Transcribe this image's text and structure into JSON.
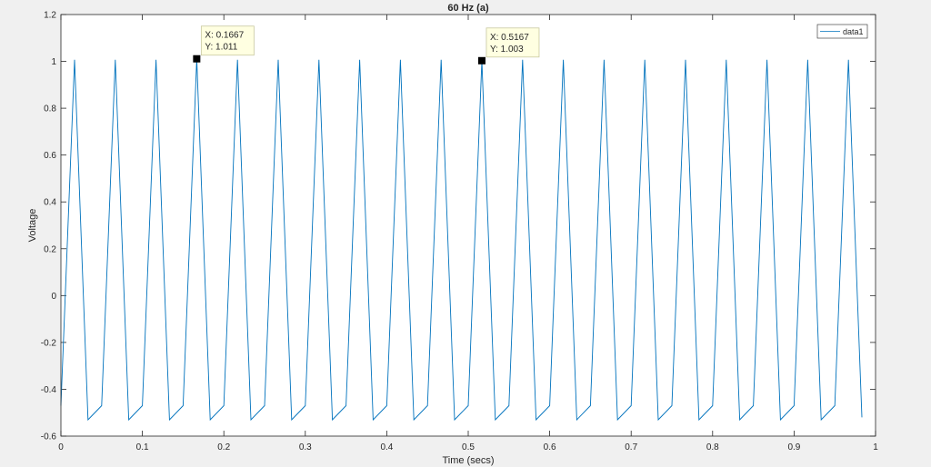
{
  "chart_data": {
    "type": "line",
    "title": "60 Hz (a)",
    "xlabel": "Time (secs)",
    "ylabel": "Voltage",
    "xlim": [
      0,
      1
    ],
    "ylim": [
      -0.6,
      1.2
    ],
    "xticks": [
      0,
      0.1,
      0.2,
      0.3,
      0.4,
      0.5,
      0.6,
      0.7,
      0.8,
      0.9,
      1
    ],
    "xtick_labels": [
      "0",
      "0.1",
      "0.2",
      "0.3",
      "0.4",
      "0.5",
      "0.6",
      "0.7",
      "0.8",
      "0.9",
      "1"
    ],
    "yticks": [
      -0.6,
      -0.4,
      -0.2,
      0,
      0.2,
      0.4,
      0.6,
      0.8,
      1,
      1.2
    ],
    "ytick_labels": [
      "-0.6",
      "-0.4",
      "-0.2",
      "0",
      "0.2",
      "0.4",
      "0.6",
      "0.8",
      "1",
      "1.2"
    ],
    "grid": false,
    "legend": {
      "placement": "top-right",
      "entries": [
        "data1"
      ]
    },
    "series": [
      {
        "name": "data1",
        "color": "#0072bd",
        "x": [
          0,
          0.0167,
          0.0333,
          0.05,
          0.0667,
          0.0833,
          0.1,
          0.1167,
          0.1333,
          0.15,
          0.1667,
          0.1833,
          0.2,
          0.2167,
          0.2333,
          0.25,
          0.2667,
          0.2833,
          0.3,
          0.3167,
          0.3333,
          0.35,
          0.3667,
          0.3833,
          0.4,
          0.4167,
          0.4333,
          0.45,
          0.4667,
          0.4833,
          0.5,
          0.5167,
          0.5333,
          0.55,
          0.5667,
          0.5833,
          0.6,
          0.6167,
          0.6333,
          0.65,
          0.6667,
          0.6833,
          0.7,
          0.7167,
          0.7333,
          0.75,
          0.7667,
          0.7833,
          0.8,
          0.8167,
          0.8333,
          0.85,
          0.8667,
          0.8833,
          0.9,
          0.9167,
          0.9333,
          0.95,
          0.9667,
          0.9833
        ],
        "y": [
          -0.47,
          1.007,
          -0.53,
          -0.47,
          1.007,
          -0.53,
          -0.47,
          1.007,
          -0.53,
          -0.47,
          1.011,
          -0.53,
          -0.47,
          1.007,
          -0.53,
          -0.47,
          1.007,
          -0.53,
          -0.47,
          1.007,
          -0.53,
          -0.47,
          1.007,
          -0.53,
          -0.47,
          1.007,
          -0.53,
          -0.47,
          1.007,
          -0.53,
          -0.47,
          1.003,
          -0.53,
          -0.47,
          1.007,
          -0.53,
          -0.47,
          1.007,
          -0.53,
          -0.47,
          1.007,
          -0.53,
          -0.47,
          1.007,
          -0.53,
          -0.47,
          1.007,
          -0.53,
          -0.47,
          1.007,
          -0.53,
          -0.47,
          1.007,
          -0.53,
          -0.47,
          1.007,
          -0.53,
          -0.47,
          1.007,
          -0.52
        ]
      }
    ],
    "annotations": [
      {
        "x": 0.1667,
        "y": 1.011,
        "label_x": "X: 0.1667",
        "label_y": "Y: 1.011"
      },
      {
        "x": 0.5167,
        "y": 1.003,
        "label_x": "X: 0.5167",
        "label_y": "Y: 1.003"
      }
    ]
  }
}
